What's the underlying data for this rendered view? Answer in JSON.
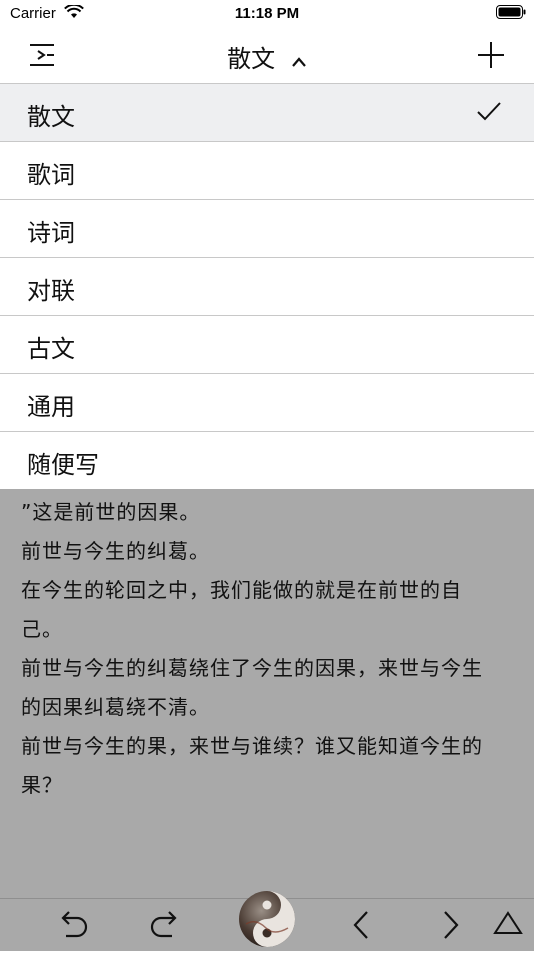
{
  "status": {
    "carrier": "Carrier",
    "time": "11:18 PM"
  },
  "nav": {
    "title": "散文"
  },
  "menu": {
    "items": [
      {
        "label": "散文",
        "selected": true
      },
      {
        "label": "歌词"
      },
      {
        "label": "诗词"
      },
      {
        "label": "对联"
      },
      {
        "label": "古文"
      },
      {
        "label": "通用"
      },
      {
        "label": "随便写"
      }
    ]
  },
  "content": {
    "lines": [
      "”这是前世的因果。",
      "前世与今生的纠葛。",
      "在今生的轮回之中，我们能做的就是在前世的自",
      "己。",
      "前世与今生的纠葛绕住了今生的因果，来世与今生",
      "的因果纠葛绕不清。",
      "前世与今生的果，来世与谁续？谁又能知道今生的",
      "果？"
    ]
  },
  "icons": {
    "menu": "menu-icon",
    "add": "plus-icon",
    "check": "checkmark-icon",
    "undo": "undo-icon",
    "redo": "redo-icon",
    "logo": "yin-yang-logo",
    "prev": "chevron-left-icon",
    "next": "chevron-right-icon",
    "up": "triangle-up-icon"
  },
  "colors": {
    "selected_row": "#eeeff1",
    "content_bg": "#a9a9a9",
    "divider": "#c8c8c8"
  }
}
